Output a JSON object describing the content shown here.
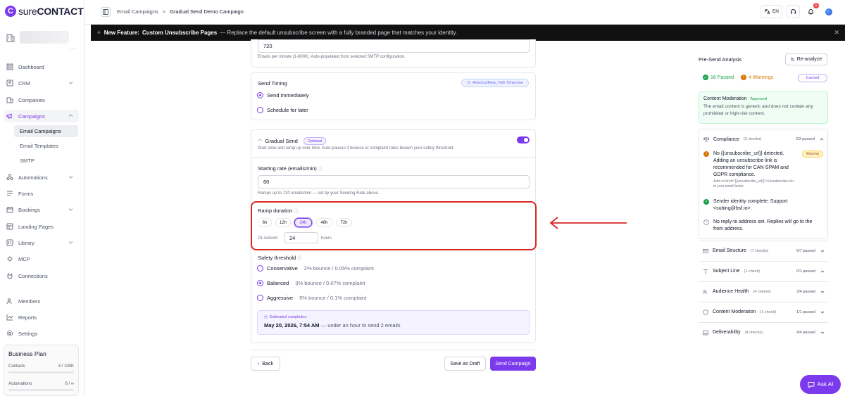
{
  "app": {
    "logo_text_light": "sure",
    "logo_text_bold": "CONTACT"
  },
  "sidebar": {
    "items": [
      {
        "label": "Dashboard"
      },
      {
        "label": "CRM"
      },
      {
        "label": "Companies"
      },
      {
        "label": "Campaigns"
      },
      {
        "label": "Email Campaigns"
      },
      {
        "label": "Email Templates"
      },
      {
        "label": "SMTP"
      },
      {
        "label": "Automations"
      },
      {
        "label": "Forms"
      },
      {
        "label": "Bookings"
      },
      {
        "label": "Landing Pages"
      },
      {
        "label": "Library"
      },
      {
        "label": "MCP"
      },
      {
        "label": "Connections"
      },
      {
        "label": "Members"
      },
      {
        "label": "Reports"
      },
      {
        "label": "Settings"
      }
    ],
    "plan": {
      "title": "Business Plan",
      "contacts_label": "Contacts",
      "contacts_value": "3 / 100K",
      "automations_label": "Automations",
      "automations_value": "0 / ∞"
    }
  },
  "header": {
    "breadcrumb": [
      "Email Campaigns",
      ">",
      "Gradual Send Demo Campaign"
    ],
    "lang": "EN",
    "notif_count": "6"
  },
  "banner": {
    "prefix": "New Feature:",
    "title": "Custom Unsubscribe Pages",
    "text": "— Replace the default unsubscribe screen with a fully branded page that matches your identity."
  },
  "form": {
    "rate_value": "720",
    "rate_help": "Emails per minute (1-6000). Auto-populated from selected SMTP configuration.",
    "timing": {
      "label": "Send Timing",
      "timezone": "America/New_York Timezone",
      "option_now": "Send immediately",
      "option_later": "Schedule for later"
    },
    "gradual": {
      "label": "Gradual Send",
      "optional": "Optional",
      "description": "Start slow and ramp up over time. Auto-pauses if bounce or complaint rates breach your safety threshold.",
      "starting_rate_label": "Starting rate (emails/min)",
      "starting_rate_value": "60",
      "starting_rate_help": "Ramps up to 720 emails/min — set by your Sending Rate above.",
      "ramp_label": "Ramp duration",
      "ramp_options": [
        "6h",
        "12h",
        "24h",
        "48h",
        "72h"
      ],
      "ramp_selected": "24h",
      "custom_label": "Or custom:",
      "custom_value": "24",
      "custom_unit": "hours",
      "safety_label": "Safety threshold",
      "safety_options": [
        {
          "name": "Conservative",
          "detail": "2% bounce / 0.05% complaint"
        },
        {
          "name": "Balanced",
          "detail": "3% bounce / 0.07% complaint"
        },
        {
          "name": "Aggressive",
          "detail": "5% bounce / 0.1% complaint"
        }
      ],
      "estimate_label": "Estimated completion",
      "estimate_date": "May 20, 2026, 7:54 AM",
      "estimate_detail": "— under an hour to send 2 emails"
    },
    "buttons": {
      "back": "Back",
      "draft": "Save as Draft",
      "send": "Send Campaign"
    }
  },
  "analysis": {
    "title": "Pre-Send Analysis",
    "reanalyze": "Re-analyze",
    "passed": "16 Passed",
    "warnings": "4 Warnings",
    "cached": "Cached",
    "moderation": {
      "title": "Content Moderation",
      "status": "Approved",
      "text": "The email content is generic and does not contain any prohibited or high-risk content."
    },
    "compliance": {
      "title": "Compliance",
      "count": "(3 checks)",
      "result": "2/3 passed",
      "items": [
        {
          "text": "No {{unsubscribe_url}} detected. Adding an unsubscribe link is recommended for CAN-SPAM and GDPR compliance.",
          "hint": "Add <a href=\"{{unsubscribe_url}}\">Unsubscribe</a> to your email footer.",
          "pill": "Warning"
        },
        {
          "text": "Sender identity complete: Support <subing@bsf.io>."
        },
        {
          "text": "No reply-to address set. Replies will go to the from address."
        }
      ]
    },
    "sections": [
      {
        "title": "Email Structure",
        "count": "(7 checks)",
        "result": "6/7 passed"
      },
      {
        "title": "Subject Line",
        "count": "(1 check)",
        "result": "0/1 passed"
      },
      {
        "title": "Audience Health",
        "count": "(4 checks)",
        "result": "3/4 passed"
      },
      {
        "title": "Content Moderation",
        "count": "(1 check)",
        "result": "1/1 passed"
      },
      {
        "title": "Deliverability",
        "count": "(4 checks)",
        "result": "4/4 passed"
      }
    ]
  },
  "ask_ai": "Ask AI",
  "colors": {
    "accent": "#7c3aed",
    "success": "#16a34a",
    "warning": "#d97706",
    "highlight": "#dc2626"
  }
}
